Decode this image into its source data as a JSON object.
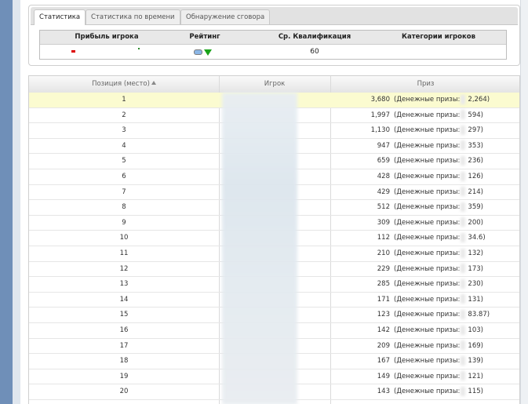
{
  "tabs": [
    {
      "label": "Статистика",
      "active": true
    },
    {
      "label": "Статистика по времени",
      "active": false
    },
    {
      "label": "Обнаружение сговора",
      "active": false
    }
  ],
  "stats": {
    "headers": {
      "profit": "Прибыль игрока",
      "rating": "Рейтинг",
      "avg_qual": "Ср. Квалификация",
      "categories": "Категории игроков"
    },
    "avg_qual_value": "60",
    "rating_icon": "rating-badge-icon",
    "rating_trend_icon": "down-arrow-icon"
  },
  "results": {
    "headers": {
      "position": "Позиция (место)",
      "player": "Игрок",
      "prize": "Приз"
    },
    "money_label": "(Денежные призы:",
    "rows": [
      {
        "pos": "1",
        "amount": "3,680",
        "money": "2,264)"
      },
      {
        "pos": "2",
        "amount": "1,997",
        "money": "594)"
      },
      {
        "pos": "3",
        "amount": "1,130",
        "money": "297)"
      },
      {
        "pos": "4",
        "amount": "947",
        "money": "353)"
      },
      {
        "pos": "5",
        "amount": "659",
        "money": "236)"
      },
      {
        "pos": "6",
        "amount": "428",
        "money": "126)"
      },
      {
        "pos": "7",
        "amount": "429",
        "money": "214)"
      },
      {
        "pos": "8",
        "amount": "512",
        "money": "359)"
      },
      {
        "pos": "9",
        "amount": "309",
        "money": "200)"
      },
      {
        "pos": "10",
        "amount": "112",
        "money": "34.6)"
      },
      {
        "pos": "11",
        "amount": "210",
        "money": "132)"
      },
      {
        "pos": "12",
        "amount": "229",
        "money": "173)"
      },
      {
        "pos": "13",
        "amount": "285",
        "money": "230)"
      },
      {
        "pos": "14",
        "amount": "171",
        "money": "131)"
      },
      {
        "pos": "15",
        "amount": "123",
        "money": "83.87)"
      },
      {
        "pos": "16",
        "amount": "142",
        "money": "103)"
      },
      {
        "pos": "17",
        "amount": "209",
        "money": "169)"
      },
      {
        "pos": "18",
        "amount": "167",
        "money": "139)"
      },
      {
        "pos": "19",
        "amount": "149",
        "money": "121)"
      },
      {
        "pos": "20",
        "amount": "143",
        "money": "115)"
      }
    ]
  }
}
